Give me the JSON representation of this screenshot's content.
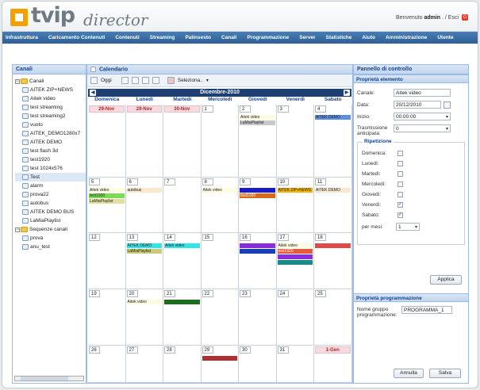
{
  "header": {
    "logo_main": "tvip",
    "logo_sub": "director",
    "welcome_prefix": "Benvenuto",
    "user": "admin",
    "welcome_suffix": ". / Esci"
  },
  "menu": [
    "Infrastruttura",
    "Caricamento Contenuti",
    "Contenuti",
    "Streaming",
    "Palinsesto",
    "Canali",
    "Programmazione",
    "Server",
    "Statistiche",
    "Aiuto",
    "Amministrazione",
    "Utente"
  ],
  "left_panel": {
    "title": "Canali"
  },
  "tree": [
    {
      "label": "Canali",
      "level": 0,
      "type": "folder"
    },
    {
      "label": "AITEK ZIP+NEWS",
      "level": 1
    },
    {
      "label": "Aitek video",
      "level": 1
    },
    {
      "label": "test streaming",
      "level": 1
    },
    {
      "label": "test streaming2",
      "level": 1
    },
    {
      "label": "vuoto",
      "level": 1
    },
    {
      "label": "AITEK_DEMO1280x7",
      "level": 1
    },
    {
      "label": "AITEK DEMO",
      "level": 1
    },
    {
      "label": "test flash 3d",
      "level": 1
    },
    {
      "label": "test1920",
      "level": 1
    },
    {
      "label": "test 1024x576",
      "level": 1
    },
    {
      "label": "Test",
      "level": 1,
      "selected": true
    },
    {
      "label": "alarm",
      "level": 1
    },
    {
      "label": "prova22",
      "level": 1
    },
    {
      "label": "autobus",
      "level": 1
    },
    {
      "label": "AITEK DEMO BUS",
      "level": 1
    },
    {
      "label": "LaMiaPlaylist",
      "level": 1
    },
    {
      "label": "Sequenze canali",
      "level": 0,
      "type": "folder"
    },
    {
      "label": "prova",
      "level": 1
    },
    {
      "label": "anu_test",
      "level": 1
    }
  ],
  "calendar": {
    "title": "Calendario",
    "toolbar": {
      "today": "Oggi",
      "select": "Seleziona.."
    },
    "month": "Dicembre-2010",
    "days": [
      "Domenica",
      "Lunedì",
      "Martedì",
      "Mercoledì",
      "Giovedì",
      "Venerdì",
      "Sabato"
    ],
    "weeks": [
      {
        "cells": [
          "29-Nov",
          "29-Nov",
          "30-Nov",
          "1",
          "2",
          "3",
          "4"
        ]
      },
      {
        "cells": [
          "5",
          "6",
          "7",
          "8",
          "9",
          "10",
          "11"
        ]
      },
      {
        "cells": [
          "12",
          "13",
          "14",
          "15",
          "16",
          "17",
          "18"
        ]
      },
      {
        "cells": [
          "19",
          "20",
          "21",
          "22",
          "23",
          "24",
          "25"
        ]
      },
      {
        "cells": [
          "26",
          "27",
          "28",
          "29",
          "30",
          "31",
          "1-Gen"
        ]
      }
    ],
    "events": [
      {
        "week": 0,
        "day": 4,
        "row": 0,
        "label": "Aitek video",
        "color": "#fdfbe0"
      },
      {
        "week": 0,
        "day": 4,
        "row": 1,
        "label": "LaMiaPlaylist",
        "color": "#c9c9c9"
      },
      {
        "week": 0,
        "day": 6,
        "row": 0,
        "label": "AITEK DEMO",
        "color": "#5b8fe0"
      },
      {
        "week": 1,
        "day": 0,
        "row": 0,
        "label": "Aitek video",
        "color": "#fdfbe0"
      },
      {
        "week": 1,
        "day": 0,
        "row": 1,
        "label": "test1920",
        "color": "#7ed957"
      },
      {
        "week": 1,
        "day": 0,
        "row": 2,
        "label": "LaMiaPlaylist",
        "color": "#e0e0a0"
      },
      {
        "week": 1,
        "day": 1,
        "row": 0,
        "label": "autobus",
        "color": "#fbe6cf"
      },
      {
        "week": 1,
        "day": 3,
        "row": 0,
        "label": "Aitek video",
        "color": "#fdfbe0"
      },
      {
        "week": 1,
        "day": 4,
        "row": 0,
        "label": "",
        "color": "#1a1ac8"
      },
      {
        "week": 1,
        "day": 4,
        "row": 1,
        "label": "test1920",
        "color": "#d46a1c"
      },
      {
        "week": 1,
        "day": 5,
        "row": 0,
        "label": "AITEK ZIP+NEWS",
        "color": "#f2b300"
      },
      {
        "week": 1,
        "day": 6,
        "row": 0,
        "label": "AITEK DEMO",
        "color": "#fbe6cf"
      },
      {
        "week": 2,
        "day": 1,
        "row": 0,
        "label": "AITEK DEMO",
        "color": "#33e6e6"
      },
      {
        "week": 2,
        "day": 1,
        "row": 1,
        "label": "LaMiaPlaylist",
        "color": "#c8cd7a"
      },
      {
        "week": 2,
        "day": 2,
        "row": 0,
        "label": "Aitek video",
        "color": "#33e6e6"
      },
      {
        "week": 2,
        "day": 4,
        "row": 0,
        "label": "",
        "color": "#8a2be2"
      },
      {
        "week": 2,
        "day": 4,
        "row": 1,
        "label": "",
        "color": "#1a3fb5"
      },
      {
        "week": 2,
        "day": 5,
        "row": 0,
        "label": "Aitek video",
        "color": "#fdfbe0"
      },
      {
        "week": 2,
        "day": 5,
        "row": 1,
        "label": "test1920",
        "color": "#e55a3a"
      },
      {
        "week": 2,
        "day": 5,
        "row": 2,
        "label": "",
        "color": "#8a2be2"
      },
      {
        "week": 2,
        "day": 5,
        "row": 3,
        "label": "",
        "color": "#1a8a8a"
      },
      {
        "week": 2,
        "day": 6,
        "row": 0,
        "label": "",
        "color": "#e24a4a"
      },
      {
        "week": 3,
        "day": 1,
        "row": 0,
        "label": "Aitek video",
        "color": "#fdfbe0"
      },
      {
        "week": 3,
        "day": 2,
        "row": 0,
        "label": "",
        "color": "#1f6b1f"
      },
      {
        "week": 4,
        "day": 3,
        "row": 0,
        "label": "",
        "color": "#b03030"
      }
    ]
  },
  "control_panel": {
    "title": "Pannello di controllo",
    "element_section": "Proprietà elemento",
    "channel_label": "Canale:",
    "channel_value": "Aitek video",
    "date_label": "Data:",
    "date_value": "20/12/2010",
    "start_label": "Inizio:",
    "start_value": "00:00:00",
    "advance_label": "Trasmissione anticipata:",
    "advance_value": "0",
    "repeat_title": "Ripetizione",
    "repeat_days": [
      {
        "label": "Domenica:",
        "checked": false
      },
      {
        "label": "Lunedì:",
        "checked": false
      },
      {
        "label": "Martedì:",
        "checked": false
      },
      {
        "label": "Mercoledì:",
        "checked": false
      },
      {
        "label": "Giovedì:",
        "checked": false
      },
      {
        "label": "Venerdì:",
        "checked": true
      },
      {
        "label": "Sabato:",
        "checked": true
      }
    ],
    "months_label": "per mesi:",
    "months_value": "1",
    "apply": "Applica",
    "program_section": "Proprietà programmazione",
    "group_label": "Nome gruppo programmazione:",
    "group_value": "PROGRAMMA_1",
    "cancel": "Annulla",
    "save": "Salva"
  }
}
